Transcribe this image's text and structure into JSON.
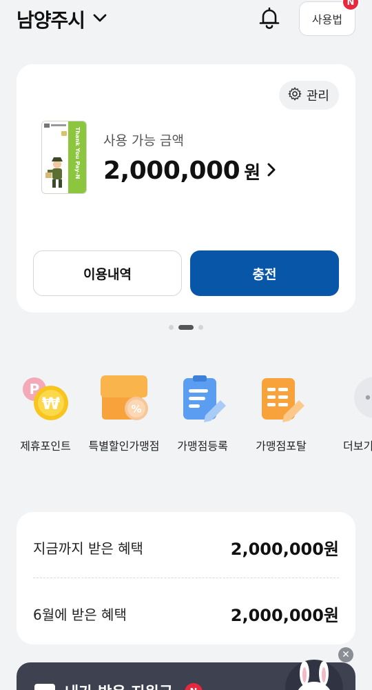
{
  "header": {
    "city": "남양주시",
    "howto_label": "사용법",
    "new_badge": "N",
    "icons": {
      "dropdown": "chevron-down-icon",
      "notification": "bell-icon"
    }
  },
  "card": {
    "manage_label": "관리",
    "card_brand_text": "Thank You Pay-N",
    "available_label": "사용 가능 금액",
    "amount": "2,000,000",
    "currency": "원",
    "history_button": "이용내역",
    "charge_button": "충전",
    "pager": {
      "count": 3,
      "active": 2
    },
    "colors": {
      "primary": "#0756a8",
      "card_green": "#8cc63f"
    }
  },
  "menu": {
    "items": [
      {
        "label": "제휴포인트",
        "icon": "partner-point-icon"
      },
      {
        "label": "특별할인가맹점",
        "icon": "discount-store-icon"
      },
      {
        "label": "가맹점등록",
        "icon": "store-register-icon"
      },
      {
        "label": "가맹점포탈",
        "icon": "store-portal-icon"
      },
      {
        "label": "더보기",
        "icon": "more-icon"
      }
    ]
  },
  "benefits": {
    "rows": [
      {
        "label": "지금까지 받은 혜택",
        "value": "2,000,000원"
      },
      {
        "label": "6월에 받은 혜택",
        "value": "2,000,000원"
      }
    ]
  },
  "banner": {
    "text": "내가 받은 지원금",
    "badge": "N",
    "close_glyph": "✕"
  }
}
